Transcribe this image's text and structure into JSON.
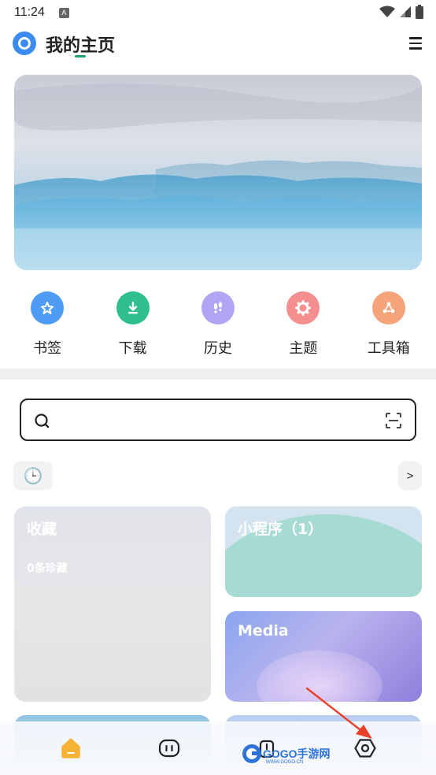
{
  "status_bar": {
    "time": "11:24",
    "notification_badge": "A"
  },
  "header": {
    "title": "我的主页"
  },
  "shortcuts": [
    {
      "label": "书签",
      "icon": "star-icon",
      "color": "#4f9cf5"
    },
    {
      "label": "下载",
      "icon": "download-icon",
      "color": "#2fbf8e"
    },
    {
      "label": "历史",
      "icon": "footprint-icon",
      "color": "#b1a4f3"
    },
    {
      "label": "主题",
      "icon": "gear-icon",
      "color": "#f58f8f"
    },
    {
      "label": "工具箱",
      "icon": "toolbox-icon",
      "color": "#f4a37a"
    }
  ],
  "search": {
    "value": "",
    "placeholder": ""
  },
  "recent": {
    "clock_icon": "🕒",
    "more_label": ">"
  },
  "cards": {
    "favorites": {
      "title": "收藏",
      "subtitle": "0条珍藏"
    },
    "mini_programs": {
      "title": "小程序（1）"
    },
    "media": {
      "title": "Media"
    }
  },
  "bottom_nav": [
    {
      "icon": "home-icon",
      "active": true
    },
    {
      "icon": "chat-icon",
      "active": false
    },
    {
      "icon": "bag-icon",
      "active": false
    },
    {
      "icon": "settings-hexagon-icon",
      "active": false
    }
  ],
  "watermark": {
    "text": "GOGO手游网",
    "sub": "WWW.GOGO.CN"
  },
  "colors": {
    "accent": "#3a8cf0",
    "home_active": "#f5b335",
    "annotation_arrow": "#e8412a"
  }
}
